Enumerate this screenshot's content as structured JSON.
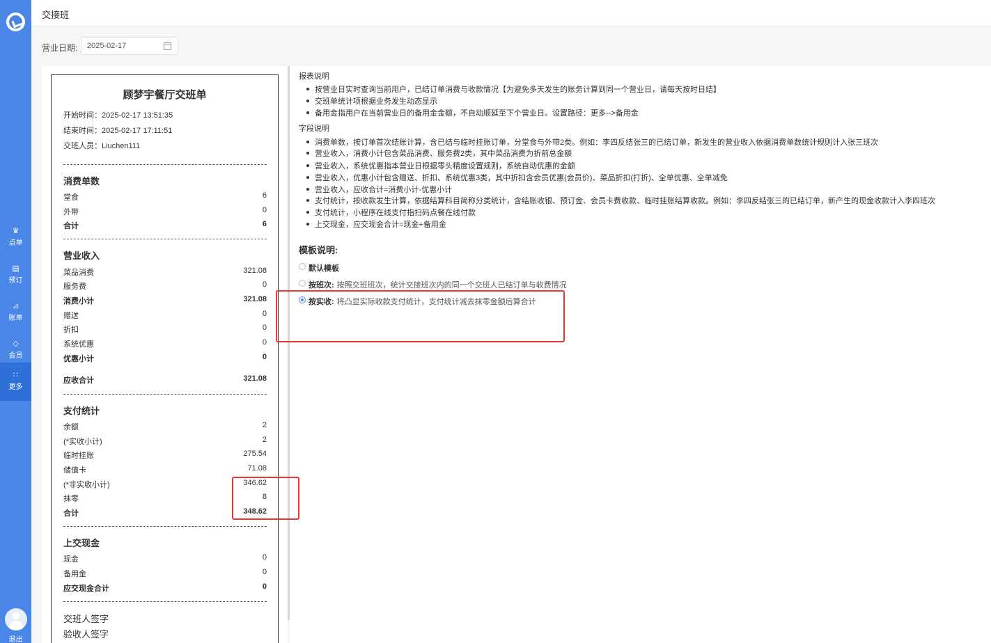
{
  "sidebar": {
    "items": [
      {
        "label": "点单",
        "icon": "chef-hat-icon"
      },
      {
        "label": "预订",
        "icon": "book-icon"
      },
      {
        "label": "账单",
        "icon": "chart-icon"
      },
      {
        "label": "会员",
        "icon": "diamond-icon"
      },
      {
        "label": "更多",
        "icon": "grid-icon"
      }
    ],
    "logout": "退出"
  },
  "header": {
    "title": "交接班"
  },
  "filter": {
    "date_label": "营业日期:",
    "date_value": "2025-02-17"
  },
  "receipt": {
    "title": "顾梦宇餐厅交班单",
    "start": "开始时间：2025-02-17 13:51:35",
    "end": "结束时间：2025-02-17 17:11:51",
    "person": "交班人员：Liuchen111",
    "sections": {
      "orders": {
        "title": "消费单数",
        "rows": [
          {
            "label": "堂食",
            "value": "6"
          },
          {
            "label": "外带",
            "value": "0"
          },
          {
            "label": "合计",
            "value": "6"
          }
        ]
      },
      "income": {
        "title": "营业收入",
        "rows": [
          {
            "label": "菜品消费",
            "value": "321.08"
          },
          {
            "label": "服务费",
            "value": "0"
          },
          {
            "label": "消费小计",
            "value": "321.08"
          },
          {
            "label": "赠送",
            "value": "0"
          },
          {
            "label": "折扣",
            "value": "0"
          },
          {
            "label": "系统优惠",
            "value": "0"
          },
          {
            "label": "优惠小计",
            "value": "0"
          },
          {
            "label": "应收合计",
            "value": "321.08"
          }
        ]
      },
      "payment": {
        "title": "支付统计",
        "rows": [
          {
            "label": "余额",
            "value": "2"
          },
          {
            "label": "(*实收小计)",
            "value": "2"
          },
          {
            "label": "临时挂账",
            "value": "275.54"
          },
          {
            "label": "储值卡",
            "value": "71.08"
          },
          {
            "label": "(*非实收小计)",
            "value": "346.62"
          },
          {
            "label": "抹零",
            "value": "8"
          },
          {
            "label": "合计",
            "value": "348.62"
          }
        ]
      },
      "cash": {
        "title": "上交现金",
        "rows": [
          {
            "label": "现金",
            "value": "0"
          },
          {
            "label": "备用金",
            "value": "0"
          },
          {
            "label": "应交现金合计",
            "value": "0"
          }
        ]
      }
    },
    "sign_handover": "交班人签字",
    "sign_receiver": "验收人签字"
  },
  "notes": {
    "report_title": "报表说明",
    "report_items": [
      "按营业日实时查询当前用户，已结订单消费与收款情况【为避免多天发生的账务计算到同一个营业日，请每天按时日结】",
      "交班单统计项根据业务发生动态显示",
      "备用金指用户在当前营业日的备用金金额，不自动顺延至下个营业日。设置路径：更多-->备用金"
    ],
    "field_title": "字段说明",
    "field_items": [
      "消费单数，按订单首次结账计算，含已结与临时挂账订单，分堂食与外带2类。例如：李四反结张三的已结订单，新发生的营业收入依据消费单数统计规则计入张三班次",
      "营业收入，消费小计包含菜品消费、服务费2类，其中菜品消费为折前总金额",
      "营业收入，系统优惠指本营业日根据零头精度设置规则，系统自动优惠的金额",
      "营业收入，优惠小计包含赠送、折扣、系统优惠3类，其中折扣含会员优惠(会员价)、菜品折扣(打折)、全单优惠、全单减免",
      "营业收入，应收合计=消费小计-优惠小计",
      "支付统计，按收款发生计算，依据结算科目简称分类统计，含结账收银、预订金、会员卡费收款、临时挂账结算收款。例如：李四反结张三的已结订单，新产生的现金收款计入李四班次",
      "支付统计，小程序在线支付指扫码点餐在线付款",
      "上交现金，应交现金合计=现金+备用金"
    ],
    "template_title": "模板说明:",
    "templates": [
      {
        "label": "默认模板",
        "desc": "",
        "checked": false
      },
      {
        "label": "按班次:",
        "desc": "按照交班班次，统计交接班次内的同一个交班人已结订单与收费情况",
        "checked": false
      },
      {
        "label": "按实收:",
        "desc": "将凸显实际收款支付统计，支付统计减去抹零金额后算合计",
        "checked": true
      }
    ]
  },
  "colors": {
    "accent": "#4a86e8",
    "highlight": "#e53935"
  }
}
